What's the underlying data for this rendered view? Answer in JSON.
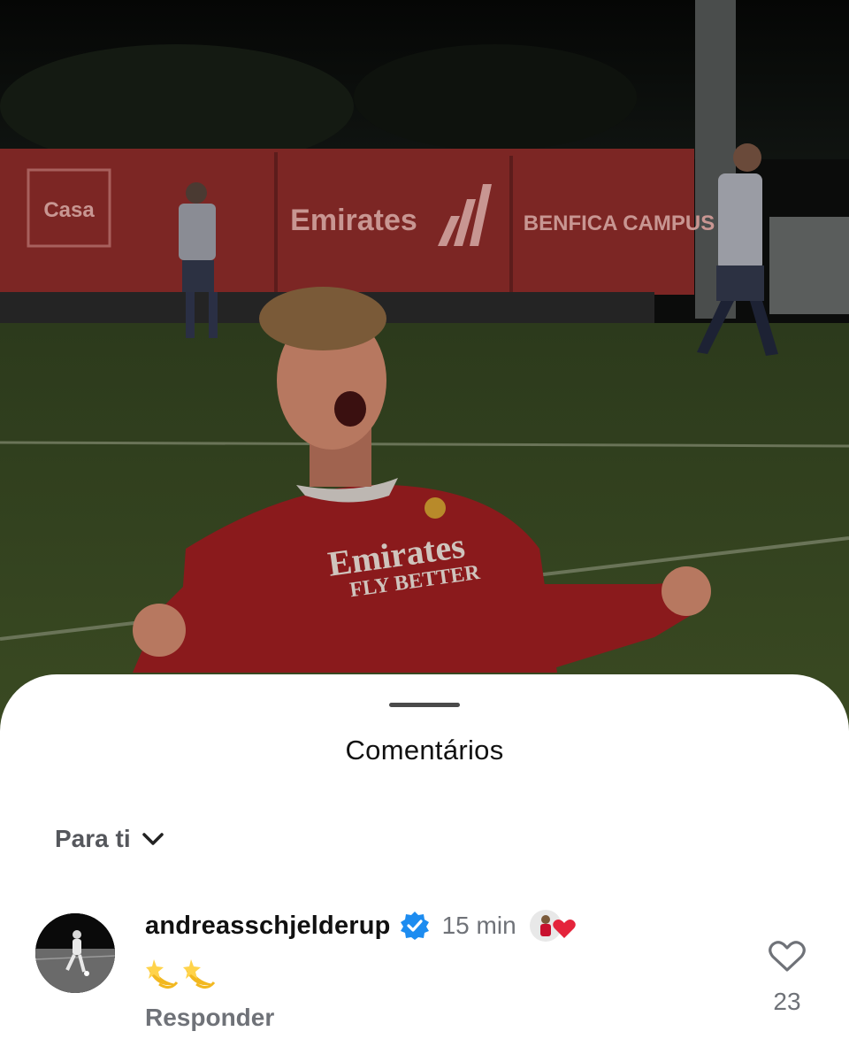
{
  "photo": {
    "banners": [
      "Casa",
      "Emirates",
      "BENFICA CAMPUS"
    ],
    "shirt_sponsor_line1": "Emirates",
    "shirt_sponsor_line2": "FLY BETTER"
  },
  "sheet": {
    "title": "Comentários",
    "filter_label": "Para ti"
  },
  "comment": {
    "username": "andreasschjelderup",
    "verified": true,
    "time": "15 min",
    "text": "💫💫",
    "reply_label": "Responder",
    "like_count": "23",
    "icons": {
      "verified": "verified-badge-icon",
      "liked_by_creator": "creator-liked-heart-icon",
      "like": "heart-outline-icon",
      "filter": "chevron-down-icon"
    }
  },
  "colors": {
    "verified_blue": "#1d8cf0",
    "heart_red": "#e4243b",
    "benfica_red": "#c8102e"
  }
}
